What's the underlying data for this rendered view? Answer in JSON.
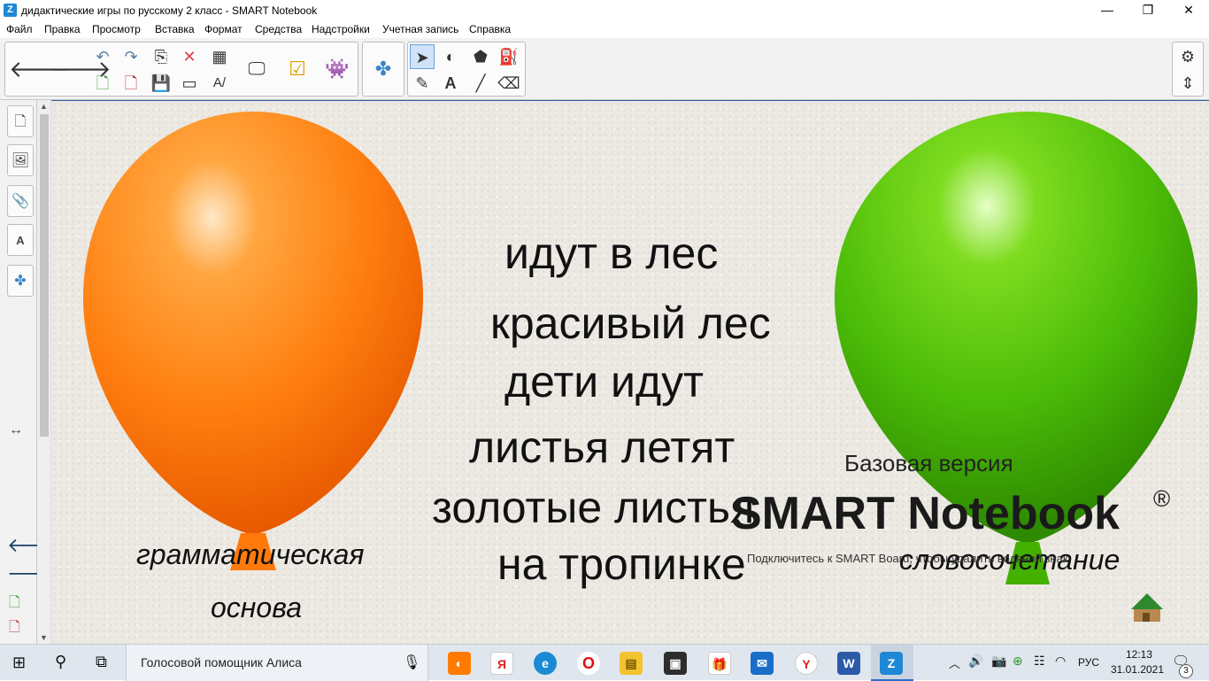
{
  "window": {
    "title": "дидактические игры по русскому 2 класс - SMART Notebook",
    "minimize": "—",
    "restore": "❐",
    "close": "✕"
  },
  "menu": [
    "Файл",
    "Правка",
    "Просмотр",
    "Вставка",
    "Формат",
    "Средства",
    "Надстройки",
    "Учетная запись",
    "Справка"
  ],
  "toolbar": {
    "back_icon": "arrow-left-icon",
    "forward_icon": "arrow-right-icon",
    "icons": [
      "undo-icon",
      "redo-icon",
      "paste-icon",
      "delete-icon",
      "table-icon",
      "add-page-icon",
      "delete-page-icon",
      "save-icon",
      "screen-shade-icon",
      "properties-icon",
      "display-icon",
      "response-icon",
      "lab-icon",
      "addons-icon",
      "select-icon",
      "shapes-icon",
      "eraser-polygon-icon",
      "fill-icon",
      "pens-icon",
      "text-icon",
      "line-icon",
      "eraser-icon",
      "settings-icon",
      "move-toolbar-icon"
    ]
  },
  "side_tabs": [
    "page-sorter-icon",
    "gallery-icon",
    "attachments-icon",
    "properties-icon",
    "addons-icon"
  ],
  "canvas": {
    "phrases": [
      "идут в лес",
      "красивый лес",
      "дети идут",
      "листья летят",
      "золотые листья",
      "на тропинке"
    ],
    "left_label_line1": "грамматическая",
    "left_label_line2": "основа",
    "right_label": "словосочетание",
    "watermark": {
      "edition": "Базовая версия",
      "product": "SMART Notebook",
      "registered": "®",
      "note": "Подключитесь к SMART Board, чтобы удалить водяной знак"
    }
  },
  "taskbar": {
    "search_text": "Голосовой помощник Алиса",
    "lang": "РУС",
    "time": "12:13",
    "date": "31.01.2021",
    "notifications": "3"
  }
}
